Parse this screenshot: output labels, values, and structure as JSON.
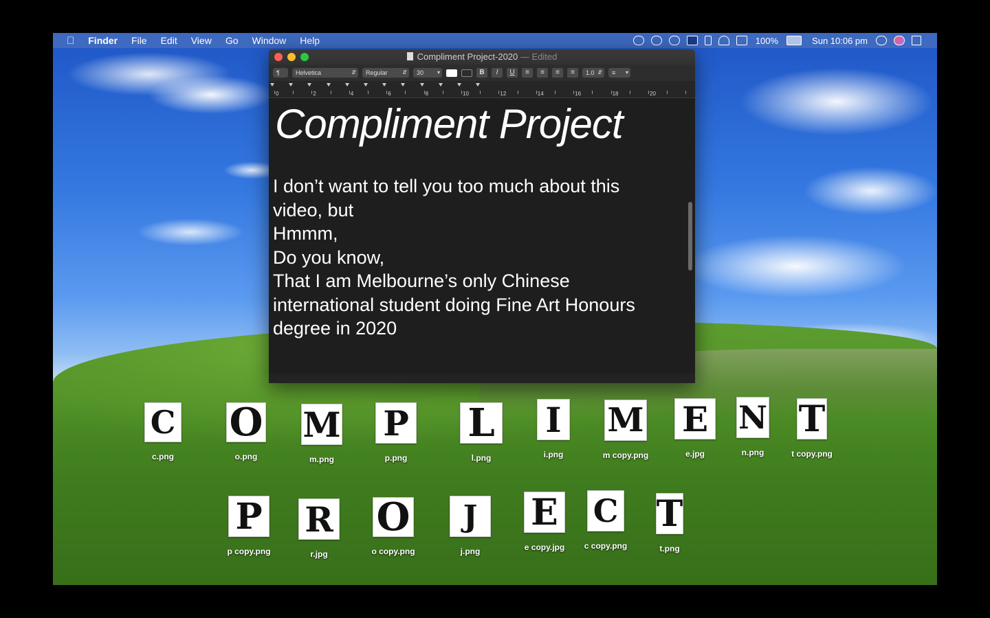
{
  "menubar": {
    "apple_icon": "apple-icon",
    "app_name": "Finder",
    "items": [
      "File",
      "Edit",
      "View",
      "Go",
      "Window",
      "Help"
    ],
    "battery": "100%",
    "clock": "Sun 10:06 pm"
  },
  "window": {
    "title": "Compliment Project-2020",
    "edited": "— Edited",
    "toolbar": {
      "paragraph": "¶",
      "font": "Helvetica",
      "style": "Regular",
      "size": "30",
      "bold": "B",
      "italic": "I",
      "underline": "U",
      "spacing": "1.0"
    },
    "ruler": [
      "0",
      "2",
      "4",
      "6",
      "8",
      "10",
      "12",
      "14",
      "16",
      "18",
      "20"
    ],
    "doc_title": "Compliment Project",
    "doc_lines": [
      "I don’t want to tell you too much about this",
      "video, but",
      "Hmmm,",
      "Do you know,",
      "That I am Melbourne’s only Chinese",
      "international student doing Fine Art Honours",
      "degree in 2020"
    ]
  },
  "desktop": {
    "row1": [
      {
        "letter": "C",
        "file": "c.png"
      },
      {
        "letter": "O",
        "file": "o.png"
      },
      {
        "letter": "M",
        "file": "m.png"
      },
      {
        "letter": "P",
        "file": "p.png"
      },
      {
        "letter": "L",
        "file": "l.png"
      },
      {
        "letter": "I",
        "file": "i.png"
      },
      {
        "letter": "M",
        "file": "m copy.png"
      },
      {
        "letter": "E",
        "file": "e.jpg"
      },
      {
        "letter": "N",
        "file": "n.png"
      },
      {
        "letter": "T",
        "file": "t copy.png"
      }
    ],
    "row2": [
      {
        "letter": "P",
        "file": "p copy.png"
      },
      {
        "letter": "R",
        "file": "r.jpg"
      },
      {
        "letter": "O",
        "file": "o copy.png"
      },
      {
        "letter": "J",
        "file": "j.png"
      },
      {
        "letter": "E",
        "file": "e copy.jpg"
      },
      {
        "letter": "C",
        "file": "c copy.png"
      },
      {
        "letter": "T",
        "file": "t.png"
      }
    ]
  }
}
